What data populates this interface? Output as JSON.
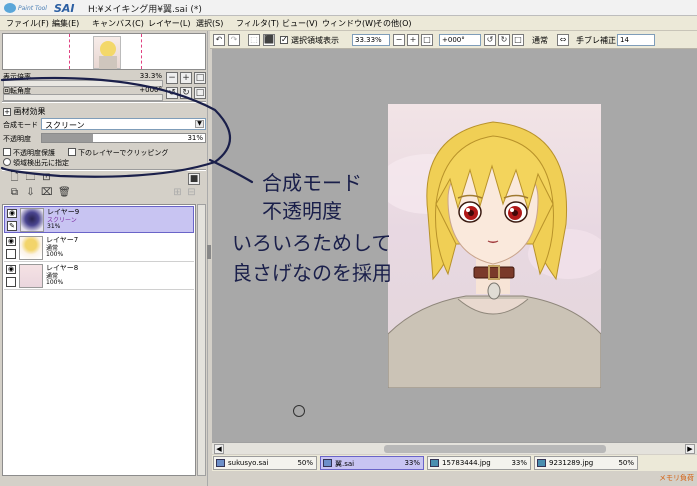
{
  "window": {
    "app_logo": "PaintTool SAI",
    "title": "H:¥メイキング用¥翼.sai (*)"
  },
  "menu": [
    "ファイル(F)",
    "編集(E)",
    "キャンバス(C)",
    "レイヤー(L)",
    "選択(S)",
    "フィルタ(T)",
    "ビュー(V)",
    "ウィンドウ(W)",
    "その他(O)"
  ],
  "navigator": {
    "zoom_label": "表示倍率",
    "zoom_value": "33.3%",
    "rotation_label": "回転角度",
    "rotation_value": "+000°"
  },
  "layer_panel": {
    "section_title": "画材効果",
    "blend_label": "合成モード",
    "blend_value": "スクリーン",
    "opacity_label": "不透明度",
    "opacity_value": "31%",
    "opacity_fraction": 0.31,
    "preserve_opacity": "不透明度保護",
    "clip_lower": "下のレイヤーでクリッピング",
    "selection_source": "領域検出元に指定"
  },
  "layers": [
    {
      "name": "レイヤー9",
      "mode": "スクリーン",
      "opacity": "31%",
      "selected": true
    },
    {
      "name": "レイヤー7",
      "mode": "通常",
      "opacity": "100%",
      "selected": false
    },
    {
      "name": "レイヤー8",
      "mode": "通常",
      "opacity": "100%",
      "selected": false
    }
  ],
  "canvas_toolbar": {
    "show_selection": "選択領域表示",
    "zoom": "33.33%",
    "rotation": "+000°",
    "blend": "通常",
    "stabilizer_label": "手ブレ補正",
    "stabilizer_value": "14"
  },
  "annotation": {
    "line1": "合成モード",
    "line2": "不透明度",
    "line3": "いろいろためして",
    "line4": "良さげなのを採用",
    "color": "#1a1f4a"
  },
  "tabs": [
    {
      "name": "sukusyo.sai",
      "pct": "50%",
      "active": false
    },
    {
      "name": "翼.sai",
      "pct": "33%",
      "active": true
    },
    {
      "name": "15783444.jpg",
      "pct": "33%",
      "active": false
    },
    {
      "name": "9231289.jpg",
      "pct": "50%",
      "active": false
    }
  ],
  "status": {
    "memory": "メモリ負荷"
  }
}
